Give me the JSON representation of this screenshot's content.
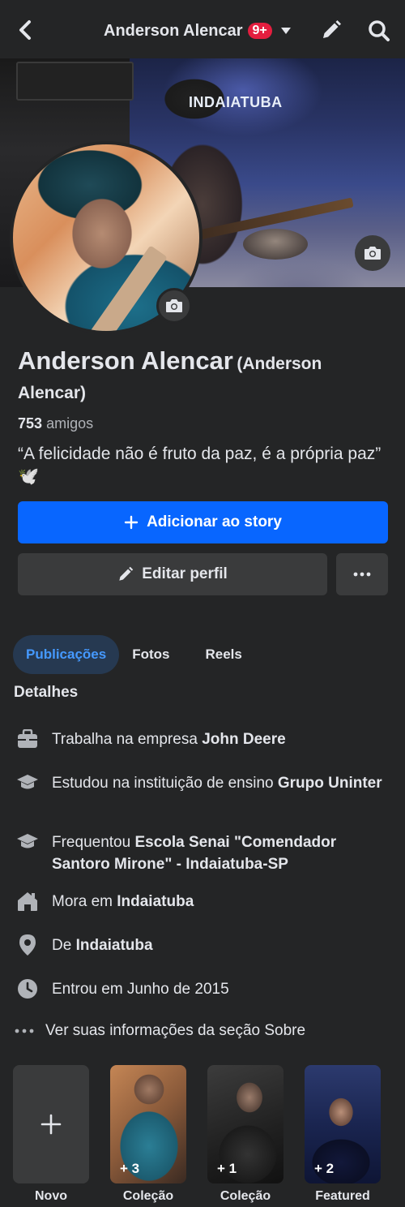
{
  "topbar": {
    "title": "Anderson Alencar",
    "notification_badge": "9+"
  },
  "cover": {
    "stage_sign": "INDAIATUBA"
  },
  "profile": {
    "name": "Anderson Alencar",
    "alternate_name": "(Anderson Alencar)",
    "friends_count": "753",
    "friends_label": "amigos",
    "bio": "“A felicidade não é fruto da paz, é a própria paz” 🕊️"
  },
  "actions": {
    "add_story": "Adicionar ao story",
    "edit_profile": "Editar perfil"
  },
  "tabs": [
    {
      "label": "Publicações",
      "active": true
    },
    {
      "label": "Fotos",
      "active": false
    },
    {
      "label": "Reels",
      "active": false
    }
  ],
  "details": {
    "title": "Detalhes",
    "items": [
      {
        "icon": "briefcase-icon",
        "prefix": "Trabalha na empresa ",
        "bold": "John Deere"
      },
      {
        "icon": "graduation-cap-icon",
        "prefix": "Estudou na instituição de ensino ",
        "bold": "Grupo Uninter"
      },
      {
        "icon": "graduation-cap-icon",
        "prefix": "Frequentou ",
        "bold": "Escola Senai \"Comendador Santoro Mirone\" - Indaiatuba-SP"
      },
      {
        "icon": "home-icon",
        "prefix": "Mora em ",
        "bold": "Indaiatuba"
      },
      {
        "icon": "location-pin-icon",
        "prefix": "De ",
        "bold": "Indaiatuba"
      },
      {
        "icon": "clock-icon",
        "prefix": "Entrou em Junho de 2015",
        "bold": ""
      }
    ],
    "see_about": "Ver suas informações da seção Sobre"
  },
  "featured": [
    {
      "label": "Novo",
      "count": ""
    },
    {
      "label": "Coleção",
      "count": "+ 3"
    },
    {
      "label": "Coleção",
      "count": "+ 1"
    },
    {
      "label": "Featured",
      "count": "+ 2"
    }
  ],
  "colors": {
    "background": "#242526",
    "primary_button": "#0866ff",
    "secondary_button": "#3a3b3c",
    "active_tab_bg": "#263951",
    "active_tab_text": "#4599ff",
    "badge": "#e41e3f"
  }
}
